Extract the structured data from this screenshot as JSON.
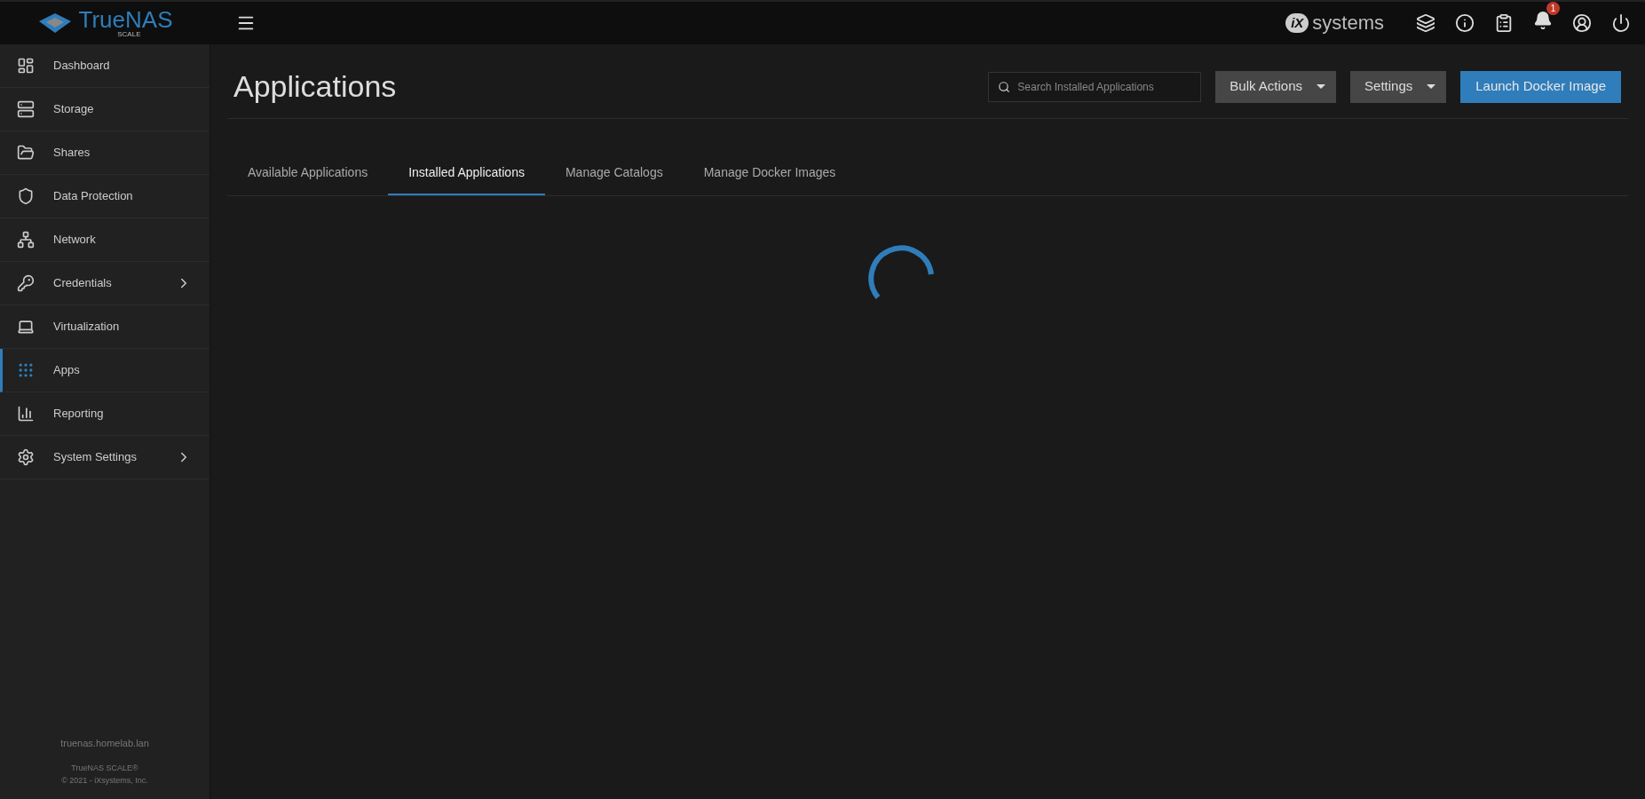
{
  "header": {
    "logo_name": "TrueNAS",
    "logo_edition": "SCALE",
    "vendor_mark": "iX",
    "vendor_name": "systems",
    "notification_count": "1"
  },
  "sidebar": {
    "items": [
      {
        "label": "Dashboard",
        "expandable": false,
        "selected": false
      },
      {
        "label": "Storage",
        "expandable": false,
        "selected": false
      },
      {
        "label": "Shares",
        "expandable": false,
        "selected": false
      },
      {
        "label": "Data Protection",
        "expandable": false,
        "selected": false
      },
      {
        "label": "Network",
        "expandable": false,
        "selected": false
      },
      {
        "label": "Credentials",
        "expandable": true,
        "selected": false
      },
      {
        "label": "Virtualization",
        "expandable": false,
        "selected": false
      },
      {
        "label": "Apps",
        "expandable": false,
        "selected": true
      },
      {
        "label": "Reporting",
        "expandable": false,
        "selected": false
      },
      {
        "label": "System Settings",
        "expandable": true,
        "selected": false
      }
    ],
    "hostname": "truenas.homelab.lan",
    "product": "TrueNAS SCALE®",
    "copyright": "© 2021 - iXsystems, Inc."
  },
  "page": {
    "title": "Applications",
    "search": {
      "placeholder": "Search Installed Applications"
    },
    "buttons": [
      {
        "label": "Bulk Actions",
        "kind": "dropdown"
      },
      {
        "label": "Settings",
        "kind": "dropdown"
      },
      {
        "label": "Launch Docker Image",
        "kind": "primary"
      }
    ],
    "tabs": [
      {
        "label": "Available Applications",
        "selected": false
      },
      {
        "label": "Installed Applications",
        "selected": true
      },
      {
        "label": "Manage Catalogs",
        "selected": false
      },
      {
        "label": "Manage Docker Images",
        "selected": false
      }
    ],
    "loading": true
  }
}
